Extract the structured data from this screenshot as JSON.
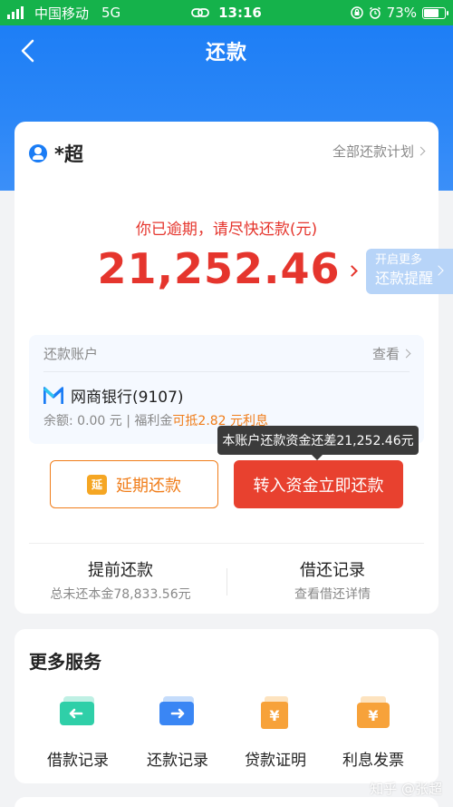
{
  "status_bar": {
    "carrier": "中国移动",
    "network": "5G",
    "time": "13:16",
    "battery_percent": "73%",
    "battery_level": 0.73
  },
  "nav": {
    "title": "还款"
  },
  "user": {
    "name": "*超"
  },
  "all_plans_label": "全部还款计划",
  "overdue_text": "你已逾期，请尽快还款(元)",
  "amount": "21,252.46",
  "remind": {
    "line1": "开启更多",
    "line2": "还款提醒"
  },
  "account": {
    "title": "还款账户",
    "view_label": "查看",
    "bank_name": "网商银行(9107)",
    "balance_prefix": "余额: 0.00 元 | 福利金",
    "balance_highlight": "可抵2.82 元利息"
  },
  "tooltip": "本账户还款资金还差21,252.46元",
  "buttons": {
    "defer_icon_text": "延",
    "defer": "延期还款",
    "repay": "转入资金立即还款"
  },
  "early_repay": {
    "title": "提前还款",
    "sub": "总未还本金78,833.56元"
  },
  "records": {
    "title": "借还记录",
    "sub": "查看借还详情"
  },
  "services": {
    "title": "更多服务",
    "items": [
      {
        "label": "借款记录",
        "icon": "loan-record-icon"
      },
      {
        "label": "还款记录",
        "icon": "repay-record-icon"
      },
      {
        "label": "贷款证明",
        "icon": "loan-certificate-icon"
      },
      {
        "label": "利息发票",
        "icon": "interest-invoice-icon"
      }
    ]
  },
  "watermark": "知乎 @张超",
  "colors": {
    "brand_blue": "#1a7cf5",
    "alert_red": "#e5352d",
    "orange": "#f07d1a",
    "status_green": "#15b24b"
  }
}
